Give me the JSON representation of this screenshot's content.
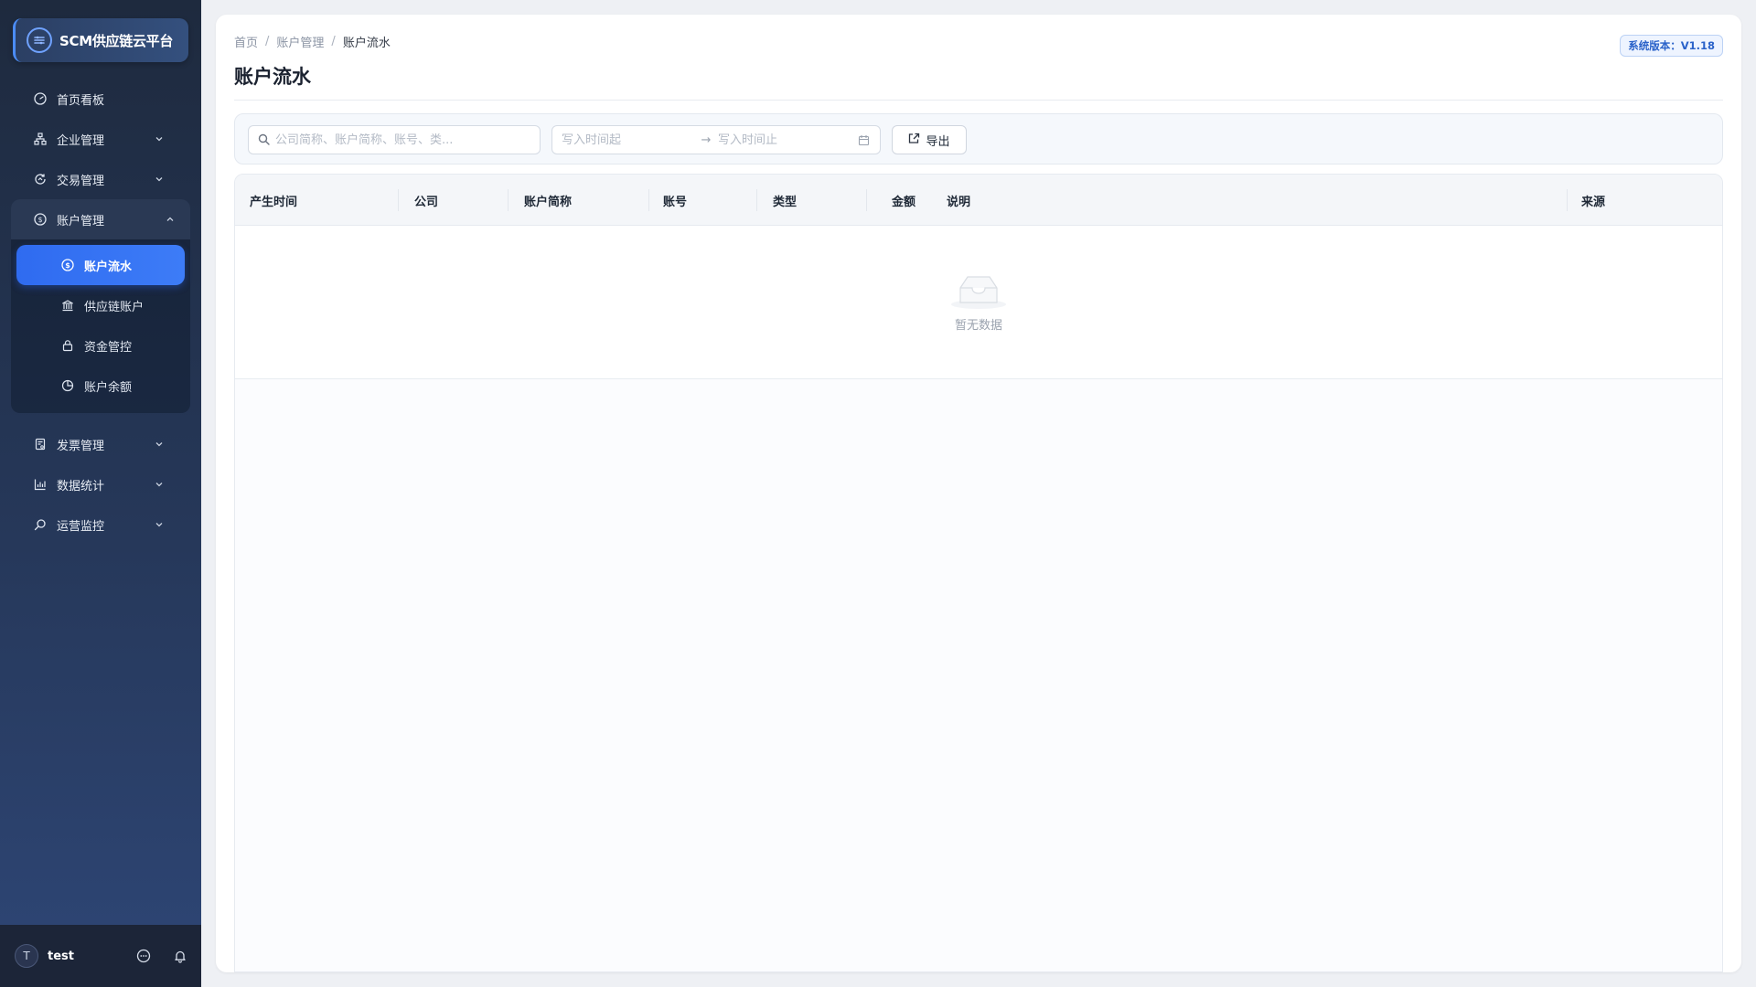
{
  "app": {
    "logo_mark": "≡",
    "title": "SCM供应链云平台"
  },
  "sidebar": {
    "items_top": [
      {
        "label": "首页看板",
        "icon": "dashboard-icon"
      },
      {
        "label": "企业管理",
        "icon": "org-icon"
      },
      {
        "label": "交易管理",
        "icon": "transaction-icon"
      }
    ],
    "open_group": {
      "label": "账户管理",
      "icon": "dollar-circle-icon",
      "children": [
        {
          "label": "账户流水",
          "icon": "dollar-circle-icon",
          "active": true
        },
        {
          "label": "供应链账户",
          "icon": "bank-icon"
        },
        {
          "label": "资金管控",
          "icon": "lock-icon"
        },
        {
          "label": "账户余额",
          "icon": "pie-icon"
        }
      ]
    },
    "items_bottom": [
      {
        "label": "发票管理",
        "icon": "invoice-icon"
      },
      {
        "label": "数据统计",
        "icon": "bar-chart-icon"
      },
      {
        "label": "运营监控",
        "icon": "monitor-search-icon"
      }
    ],
    "footer": {
      "avatar_initial": "T",
      "username": "test"
    }
  },
  "header": {
    "breadcrumb": [
      "首页",
      "账户管理",
      "账户流水"
    ],
    "breadcrumb_sep": "/",
    "title": "账户流水",
    "version": "系统版本：V1.18"
  },
  "filters": {
    "search_placeholder": "公司简称、账户简称、账号、类...",
    "search_value": "",
    "date_start_placeholder": "写入时间起",
    "date_end_placeholder": "写入时间止",
    "date_arrow": "→",
    "export_label": "导出"
  },
  "table": {
    "columns": [
      "产生时间",
      "公司",
      "账户简称",
      "账号",
      "类型",
      "金额",
      "说明",
      "来源"
    ],
    "rows": [],
    "empty_text": "暂无数据"
  },
  "colors": {
    "accent": "#2f6bf0",
    "sidebar_bg": "#1e2a3e",
    "version_text": "#2a62c9"
  }
}
